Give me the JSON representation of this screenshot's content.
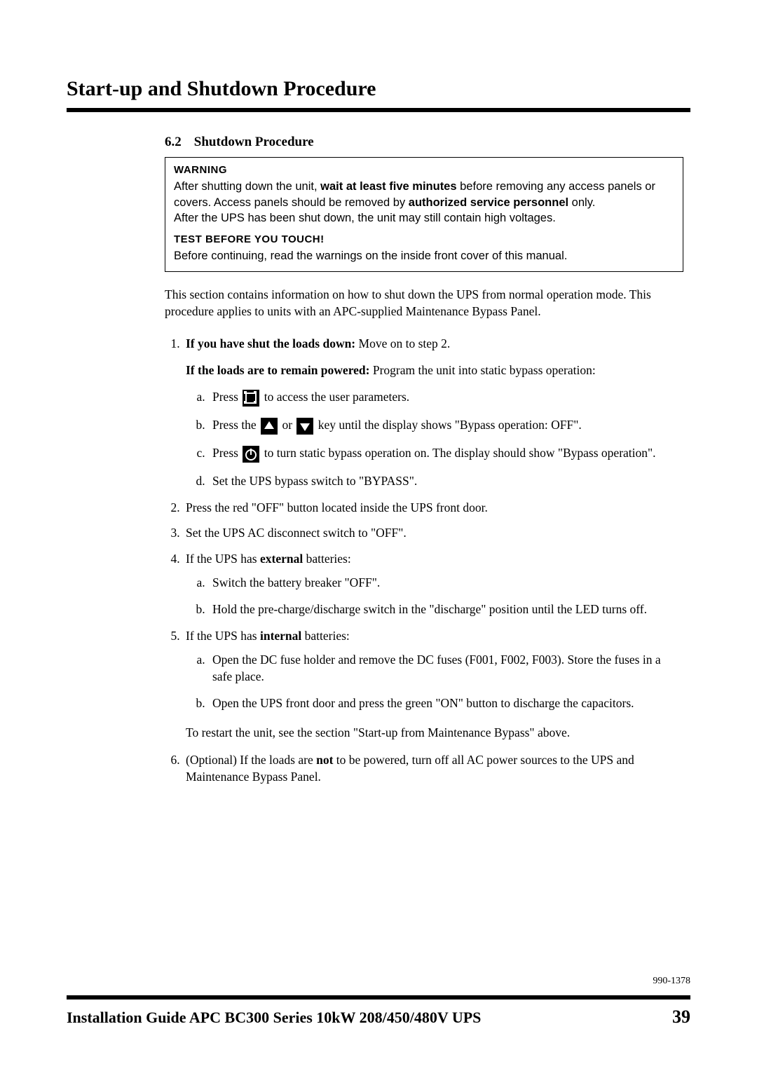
{
  "header": {
    "title": "Start-up and Shutdown Procedure"
  },
  "section": {
    "num": "6.2",
    "title": "Shutdown Procedure"
  },
  "warning": {
    "head1": "WARNING",
    "p1_a": "After shutting down the unit, ",
    "p1_b": "wait at least five minutes",
    "p1_c": " before removing any access panels or covers. Access panels should be removed by ",
    "p1_d": "authorized service personnel",
    "p1_e": " only.",
    "p2": "After the UPS has been shut down, the unit may still contain high voltages.",
    "head2": "TEST BEFORE YOU TOUCH!",
    "p3": "Before continuing, read the warnings on the inside front cover of this manual."
  },
  "intro": "This section contains information on how to shut down the UPS from normal operation mode. This procedure applies to units with an APC-supplied Maintenance Bypass Panel.",
  "steps": {
    "s1": {
      "lead_b": "If you have shut the loads down:",
      "lead_t": " Move on to step 2.",
      "alt_b": "If the loads are to remain powered:",
      "alt_t": " Program the unit into static bypass operation:",
      "a_pre": "Press ",
      "a_post": " to access the user parameters.",
      "b_pre": "Press the ",
      "b_mid": " or ",
      "b_post": " key until the display shows \"Bypass operation: OFF\".",
      "c_pre": "Press ",
      "c_post": " to turn static bypass operation on. The display should show \"Bypass operation\".",
      "d": "Set the UPS bypass switch to \"BYPASS\"."
    },
    "s2": "Press the red \"OFF\" button located inside the UPS front door.",
    "s3": "Set the UPS AC disconnect switch to \"OFF\".",
    "s4": {
      "lead_a": "If the UPS has ",
      "lead_b": "external",
      "lead_c": " batteries:",
      "a": "Switch the battery breaker \"OFF\".",
      "b": "Hold the pre-charge/discharge switch in the \"discharge\" position until the LED turns off."
    },
    "s5": {
      "lead_a": "If the UPS has ",
      "lead_b": "internal",
      "lead_c": " batteries:",
      "a": "Open the DC fuse holder and remove the DC fuses (F001, F002, F003). Store the fuses in a safe place.",
      "b": "Open the UPS front door and press the green \"ON\" button to discharge the capacitors.",
      "note": "To restart the unit, see the section \"Start-up from Maintenance Bypass\" above."
    },
    "s6": {
      "a": "(Optional) If the loads are ",
      "b": "not",
      "c": " to be powered, turn off all AC power sources to the UPS and Maintenance Bypass Panel."
    }
  },
  "footer": {
    "docnum": "990-1378",
    "title": "Installation Guide APC BC300 Series 10kW 208/450/480V UPS",
    "page": "39"
  }
}
